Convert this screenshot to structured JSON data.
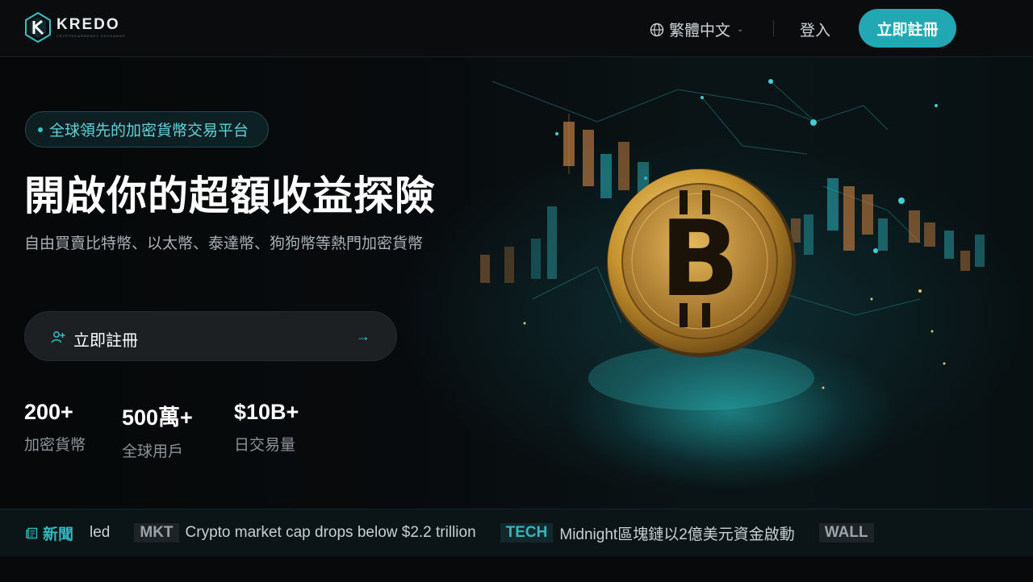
{
  "header": {
    "logo_text": "KREDO",
    "logo_sub": "CRYPTOCURRENCY EXCHANGE",
    "language": "繁體中文",
    "login": "登入",
    "signup": "立即註冊"
  },
  "hero": {
    "badge": "全球領先的加密貨幣交易平台",
    "title": "開啟你的超額收益探險",
    "subtitle": "自由買賣比特幣、以太幣、泰達幣、狗狗幣等熱門加密貨幣",
    "cta_label": "立即註冊",
    "stats": [
      {
        "value": "200+",
        "label": "加密貨幣"
      },
      {
        "value": "500萬+",
        "label": "全球用戶"
      },
      {
        "value": "$10B+",
        "label": "日交易量"
      }
    ]
  },
  "ticker": {
    "label": "新聞",
    "lead": "led",
    "items": [
      {
        "tag": "MKT",
        "text": "Crypto market cap drops below $2.2 trillion"
      },
      {
        "tag": "TECH",
        "text": "Midnight區塊鏈以2億美元資金啟動"
      },
      {
        "tag": "WALL",
        "text": ""
      }
    ]
  },
  "colors": {
    "accent": "#22a8b2",
    "background": "#07090b"
  },
  "icons": [
    "globe-icon",
    "chevron-down-icon",
    "user-plus-icon",
    "arrow-right-icon",
    "newspaper-icon",
    "bitcoin-coin"
  ]
}
